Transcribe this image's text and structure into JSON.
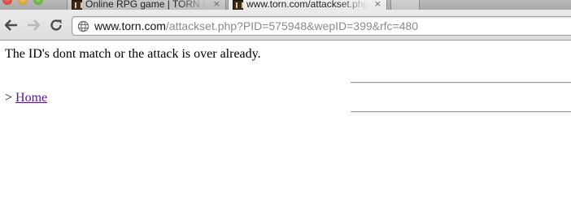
{
  "browser": {
    "tabs": [
      {
        "title": "Online RPG game | TORN City",
        "active": false
      },
      {
        "title": "www.torn.com/attackset.php",
        "active": true
      }
    ],
    "close_glyph": "×",
    "address": {
      "host": "www.torn.com",
      "path": "/attackset.php?PID=575948&wepID=399&rfc=480"
    },
    "icons": {
      "back": "arrow-left-icon",
      "forward": "arrow-right-icon",
      "reload": "reload-icon",
      "site": "globe-icon"
    }
  },
  "page": {
    "message": "The ID's dont match or the attack is over already.",
    "nav_prefix": ">",
    "home_link": "Home",
    "link_color": "#551a8b"
  }
}
